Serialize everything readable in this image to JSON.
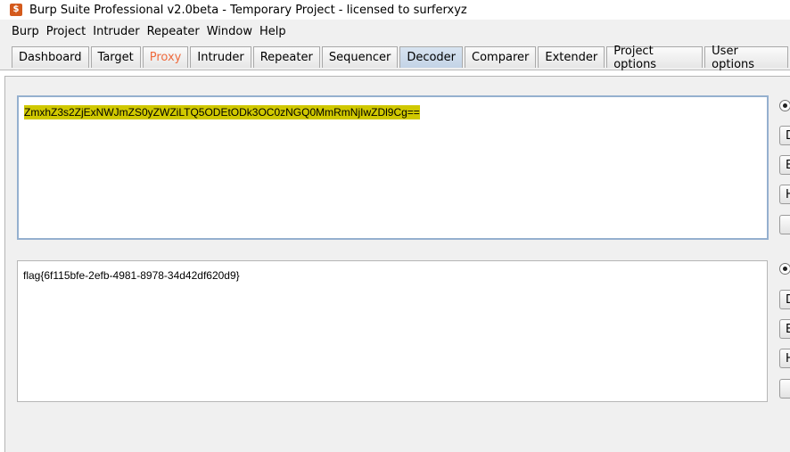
{
  "window": {
    "title": "Burp Suite Professional v2.0beta - Temporary Project - licensed to surferxyz",
    "icon": "burp-icon"
  },
  "menu": [
    "Burp",
    "Project",
    "Intruder",
    "Repeater",
    "Window",
    "Help"
  ],
  "tabs": [
    "Dashboard",
    "Target",
    "Proxy",
    "Intruder",
    "Repeater",
    "Sequencer",
    "Decoder",
    "Comparer",
    "Extender",
    "Project options",
    "User options"
  ],
  "active_tab": "Decoder",
  "colors": {
    "proxy_tab_text": "#ef6b3e",
    "selection_highlight": "#d0c800",
    "input_panel_border": "#95b0cf"
  },
  "decoder": {
    "input_text": "ZmxhZ3s2ZjExNWJmZS0yZWZiLTQ5ODEtODk3OC0zNGQ0MmRmNjIwZDl9Cg==",
    "output_text": "flag{6f115bfe-2efb-4981-8978-34d42df620d9}",
    "input_side": {
      "buttons": [
        "D",
        "E",
        "H",
        ""
      ]
    },
    "output_side": {
      "buttons": [
        "D",
        "E",
        "H",
        ""
      ]
    }
  }
}
